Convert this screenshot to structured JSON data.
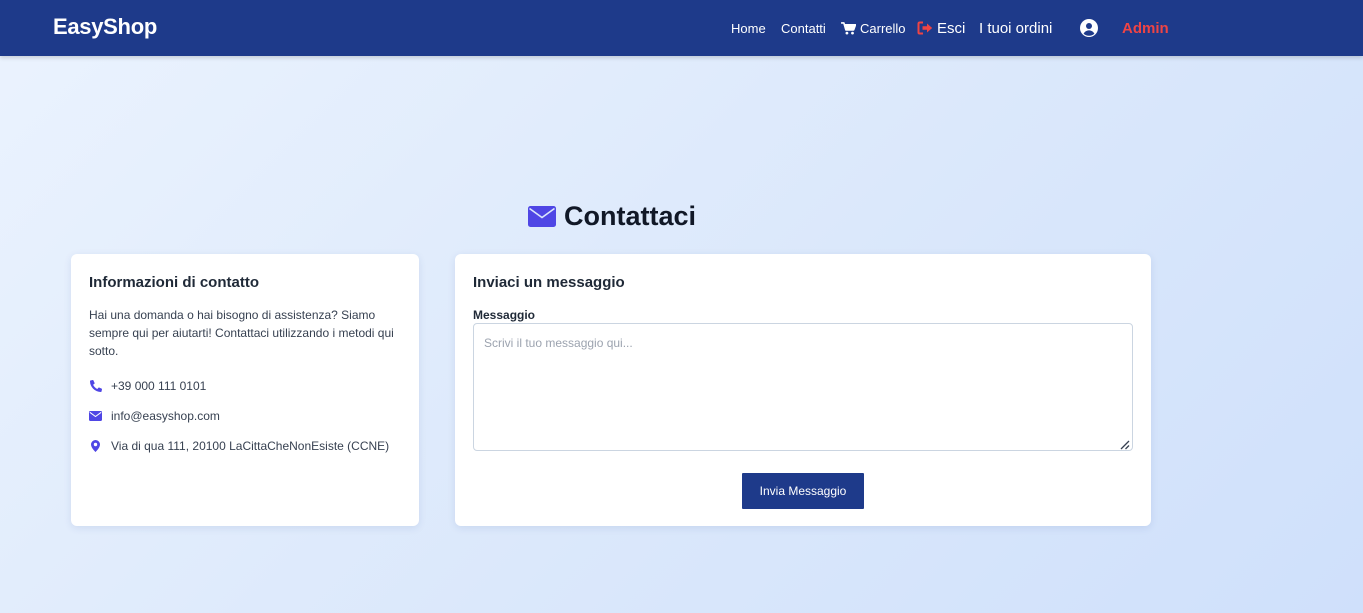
{
  "navbar": {
    "brand": "EasyShop",
    "items": [
      {
        "label": "Home"
      },
      {
        "label": "Contatti"
      },
      {
        "label": "Carrello",
        "icon": "cart-icon"
      },
      {
        "label": "Esci",
        "icon": "sign-out-icon"
      },
      {
        "label": "I tuoi ordini"
      },
      {
        "label": "",
        "icon": "user-circle-icon"
      },
      {
        "label": "Admin"
      }
    ]
  },
  "page": {
    "title": "Contattaci",
    "title_icon": "envelope-icon"
  },
  "contact_info": {
    "title": "Informazioni di contatto",
    "description": "Hai una domanda o hai bisogno di assistenza? Siamo sempre qui per aiutarti! Contattaci utilizzando i metodi qui sotto.",
    "phone": "+39 000 111 0101",
    "email": "info@easyshop.com",
    "address": "Via di qua 111, 20100 LaCittaCheNonEsiste (CCNE)"
  },
  "message_form": {
    "title": "Inviaci un messaggio",
    "field_label": "Messaggio",
    "placeholder": "Scrivi il tuo messaggio qui...",
    "value": "",
    "submit_label": "Invia Messaggio"
  },
  "colors": {
    "navbar": "#1e3a8a",
    "accent_icon": "#4f46e5",
    "danger": "#ef4444",
    "button": "#1e3a8a"
  }
}
